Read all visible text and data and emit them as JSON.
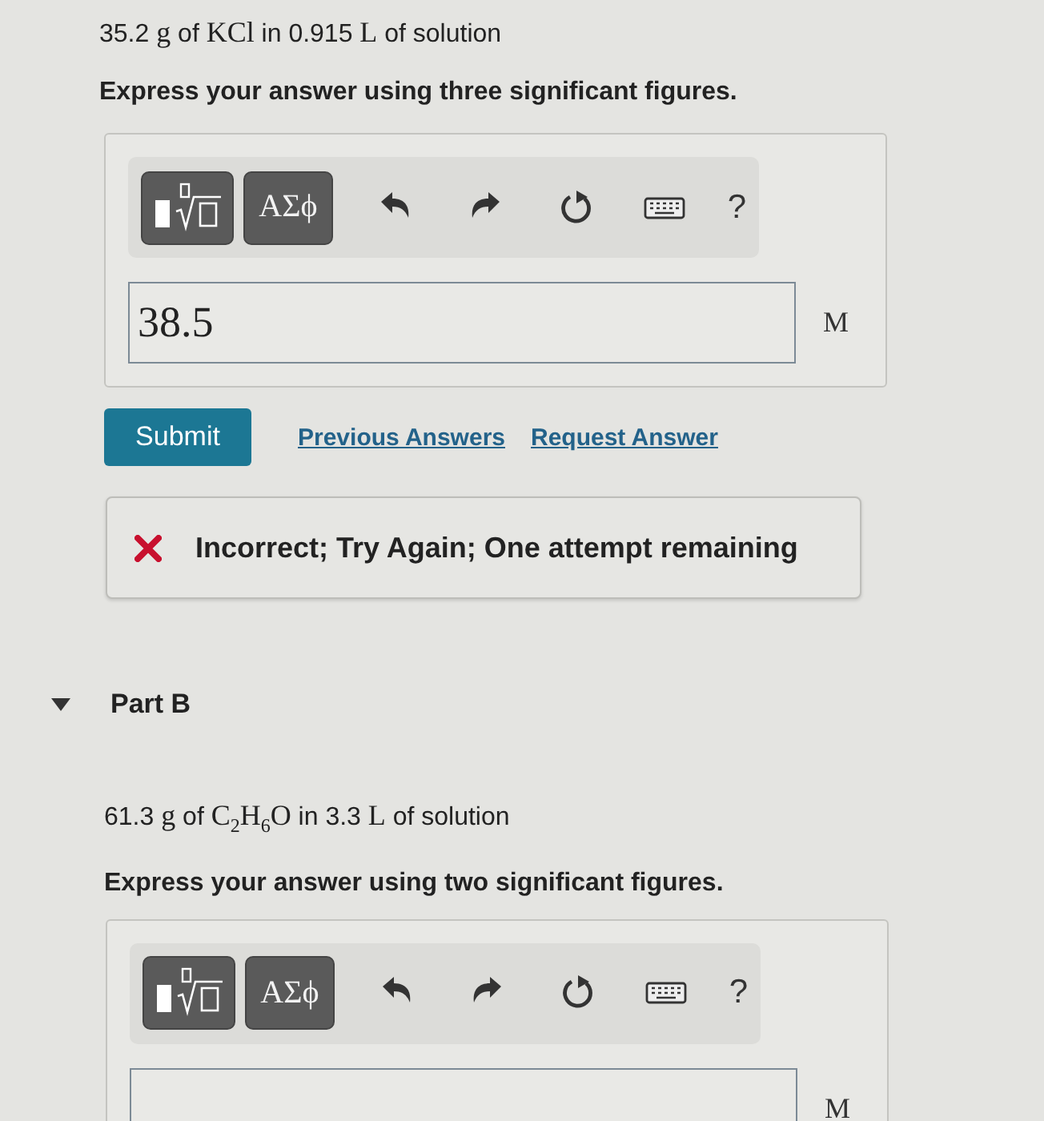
{
  "part_a": {
    "statement": [
      {
        "kind": "text",
        "text": "35.2 "
      },
      {
        "kind": "math",
        "text": "g"
      },
      {
        "kind": "text",
        "text": " of "
      },
      {
        "kind": "math",
        "text": "KCl"
      },
      {
        "kind": "text",
        "text": " in 0.915 "
      },
      {
        "kind": "math",
        "text": "L"
      },
      {
        "kind": "text",
        "text": " of solution"
      }
    ],
    "instruction": "Express your answer using three significant figures.",
    "answer": {
      "symbols_button": "ΑΣϕ",
      "help": "?",
      "value": "38.5",
      "unit": "M"
    },
    "submit": "Submit",
    "links": [
      "Previous Answers",
      "Request Answer"
    ],
    "feedback": {
      "kind": "incorrect",
      "text": "Incorrect; Try Again; One attempt remaining"
    }
  },
  "part_b": {
    "expanded": true,
    "title": "Part B",
    "statement": [
      {
        "kind": "text",
        "text": "61.3 "
      },
      {
        "kind": "math",
        "text": "g"
      },
      {
        "kind": "text",
        "text": " of "
      },
      {
        "kind": "math",
        "text": "C$_{2}$H$_{6}$O"
      },
      {
        "kind": "text",
        "text": " in 3.3 "
      },
      {
        "kind": "math",
        "text": "L"
      },
      {
        "kind": "text",
        "text": " of solution"
      }
    ],
    "instruction": "Express your answer using two significant figures.",
    "answer": {
      "symbols_button": "ΑΣϕ",
      "help": "?",
      "unit": "M"
    }
  }
}
